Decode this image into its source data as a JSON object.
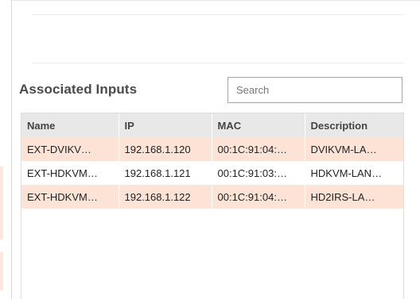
{
  "section": {
    "title": "Associated Inputs"
  },
  "search": {
    "placeholder": "Search",
    "value": ""
  },
  "table": {
    "columns": [
      "Name",
      "IP",
      "MAC",
      "Description"
    ],
    "rows": [
      {
        "name": "EXT-DVIKV…",
        "ip": "192.168.1.120",
        "mac": "00:1C:91:04:…",
        "description": "DVIKVM-LA…"
      },
      {
        "name": "EXT-HDKVM…",
        "ip": "192.168.1.121",
        "mac": "00:1C:91:03:…",
        "description": "HDKVM-LAN…"
      },
      {
        "name": "EXT-HDKVM…",
        "ip": "192.168.1.122",
        "mac": "00:1C:91:04:…",
        "description": "HD2IRS-LA…"
      }
    ]
  },
  "colors": {
    "highlight_row": "#fde3d6",
    "header_bg": "#e8e8e8",
    "title_text": "#4a4a4a"
  }
}
